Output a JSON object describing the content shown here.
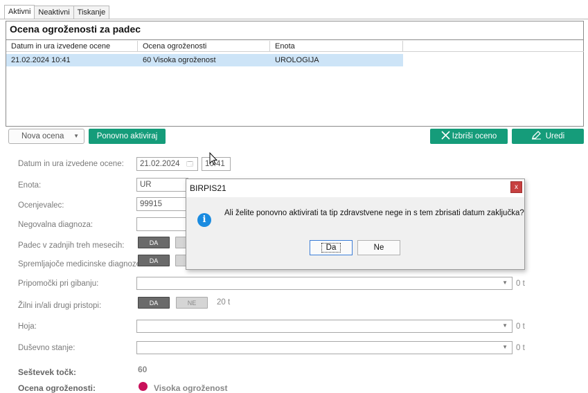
{
  "tabs": [
    "Aktivni",
    "Neaktivni",
    "Tiskanje"
  ],
  "section": {
    "title": "Ocena ogroženosti za padec",
    "columns": [
      "Datum in ura izvedene ocene",
      "Ocena ogroženosti",
      "Enota"
    ],
    "rows": [
      {
        "date": "21.02.2024 10:41",
        "score": "60  Visoka ogroženost",
        "unit": "UROLOGIJA"
      }
    ]
  },
  "toolbar": {
    "nova": "Nova ocena",
    "ponovno": "Ponovno aktiviraj",
    "izbrisi": "Izbriši oceno",
    "uredi": "Uredi"
  },
  "form": {
    "date_label": "Datum in ura izvedene ocene:",
    "date_value": "21.02.2024",
    "time_value": "10:41",
    "enota_label": "Enota:",
    "enota_value": "UR",
    "ocenjevalec_label": "Ocenjevalec:",
    "ocenjevalec_value": "99915",
    "negovalna_label": "Negovalna diagnoza:",
    "padec_label": "Padec v zadnjih treh mesecih:",
    "spremljajoce_label": "Spremljajoče medicinske diagnoze:",
    "pripomocki_label": "Pripomočki pri gibanju:",
    "zilni_label": "Žilni in/ali drugi pristopi:",
    "hoja_label": "Hoja:",
    "dusevno_label": "Duševno stanje:",
    "da": "DA",
    "ne": "NE",
    "zero_t": "0 t",
    "twenty_t": "20 t",
    "sestevek_label": "Seštevek točk:",
    "sestevek_value": "60",
    "ocena_label": "Ocena ogroženosti:",
    "ocena_value": "Visoka ogroženost"
  },
  "dialog": {
    "title": "BIRPIS21",
    "close": "x",
    "message": "Ali želite ponovno aktivirati ta tip zdravstvene nege in s tem zbrisati datum zaključka?",
    "yes": "Da",
    "no": "Ne"
  },
  "colors": {
    "green": "#159c7a",
    "selected_row": "#cde4f7",
    "danger_dot": "#c8105a",
    "info": "#1a8be0"
  }
}
